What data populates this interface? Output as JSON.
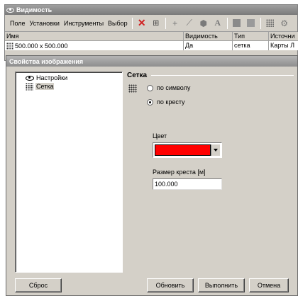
{
  "visibility_window": {
    "title": "Видимость",
    "menu": [
      "Поле",
      "Установки",
      "Инструменты",
      "Выбор"
    ],
    "toolbar_icons": [
      "delete-icon",
      "properties-icon",
      "add-point-icon",
      "add-line-icon",
      "add-polygon-icon",
      "add-text-icon",
      "layer-icon",
      "layer-alt-icon",
      "grid-icon",
      "settings-icon"
    ],
    "table": {
      "columns": [
        "Имя",
        "Видимость",
        "Тип",
        "Источни"
      ],
      "rows": [
        {
          "name": "500.000 x 500.000",
          "visibility": "Да",
          "type": "сетка",
          "source": "Карты Л"
        }
      ]
    }
  },
  "dialog": {
    "title": "Свойства изображения",
    "tree": [
      {
        "label": "Настройки",
        "icon": "eye-icon"
      },
      {
        "label": "Сетка",
        "icon": "grid-icon",
        "selected": true
      }
    ],
    "group_title": "Сетка",
    "radio_by_symbol": "по символу",
    "radio_by_cross": "по кресту",
    "selected_mode": "по кресту",
    "color_label": "Цвет",
    "color_value": "#ff0000",
    "cross_size_label": "Размер креста [м]",
    "cross_size_value": "100.000",
    "buttons": {
      "reset": "Сброс",
      "update": "Обновить",
      "run": "Выполнить",
      "cancel": "Отмена"
    }
  }
}
